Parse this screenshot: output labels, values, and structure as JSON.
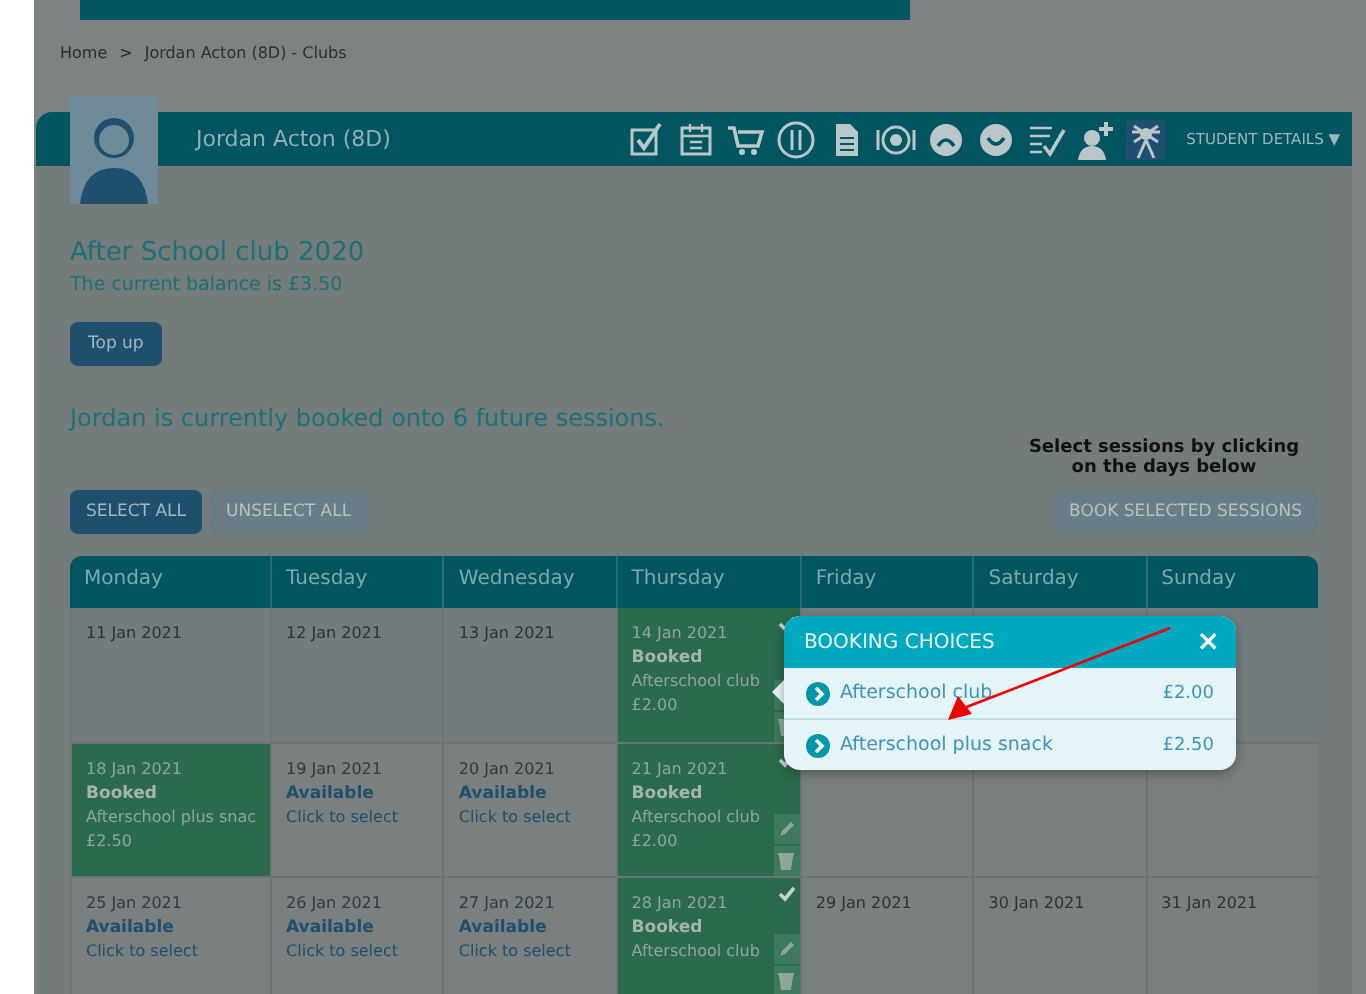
{
  "breadcrumb": [
    "Home",
    ">",
    "Jordan Acton (8D) - Clubs"
  ],
  "student": {
    "name": "Jordan Acton (8D)",
    "menu_label": "STUDENT DETAILS",
    "menu_caret": "▼"
  },
  "club": {
    "title": "After School club 2020",
    "balance": "The current balance is £3.50",
    "top_up": "Top up",
    "booked_summary": "Jordan is currently booked onto 6 future sessions.",
    "hint": "Select sessions by clicking on the days below"
  },
  "actions": [
    {
      "label": "SELECT ALL",
      "disabled": false
    },
    {
      "label": "UNSELECT ALL",
      "disabled": true
    }
  ],
  "book_button": {
    "label": "BOOK SELECTED SESSIONS",
    "disabled": true
  },
  "calendar": {
    "days": [
      "Monday",
      "Tuesday",
      "Wednesday",
      "Thursday",
      "Friday",
      "Saturday",
      "Sunday"
    ],
    "rows": [
      [
        {
          "kind": "past",
          "date": "11 Jan 2021"
        },
        {
          "kind": "past",
          "date": "12 Jan 2021"
        },
        {
          "kind": "past",
          "date": "13 Jan 2021"
        },
        {
          "kind": "booked",
          "date": "14 Jan 2021",
          "status": "Booked",
          "detail": "Afterschool club",
          "price": "£2.00",
          "editable": true
        },
        {
          "kind": "empty"
        },
        {
          "kind": "empty"
        },
        {
          "kind": "empty"
        }
      ],
      [
        {
          "kind": "booked",
          "date": "18 Jan 2021",
          "status": "Booked",
          "detail": "Afterschool plus snac",
          "price": "£2.50",
          "editable": false
        },
        {
          "kind": "available",
          "date": "19 Jan 2021",
          "status": "Available",
          "detail": "Click to select"
        },
        {
          "kind": "available",
          "date": "20 Jan 2021",
          "status": "Available",
          "detail": "Click to select"
        },
        {
          "kind": "booked",
          "date": "21 Jan 2021",
          "status": "Booked",
          "detail": "Afterschool club",
          "price": "£2.00",
          "editable": true
        },
        {
          "kind": "empty"
        },
        {
          "kind": "empty"
        },
        {
          "kind": "empty"
        }
      ],
      [
        {
          "kind": "available",
          "date": "25 Jan 2021",
          "status": "Available",
          "detail": "Click to select"
        },
        {
          "kind": "available",
          "date": "26 Jan 2021",
          "status": "Available",
          "detail": "Click to select"
        },
        {
          "kind": "available",
          "date": "27 Jan 2021",
          "status": "Available",
          "detail": "Click to select"
        },
        {
          "kind": "booked",
          "date": "28 Jan 2021",
          "status": "Booked",
          "detail": "Afterschool club",
          "editable": true
        },
        {
          "kind": "past",
          "date": "29 Jan 2021"
        },
        {
          "kind": "past",
          "date": "30 Jan 2021"
        },
        {
          "kind": "past",
          "date": "31 Jan 2021"
        }
      ]
    ]
  },
  "popup": {
    "title": "BOOKING CHOICES",
    "close": "×",
    "choices": [
      {
        "label": "Afterschool club",
        "price": "£2.00"
      },
      {
        "label": "Afterschool plus snack",
        "price": "£2.50"
      }
    ]
  }
}
